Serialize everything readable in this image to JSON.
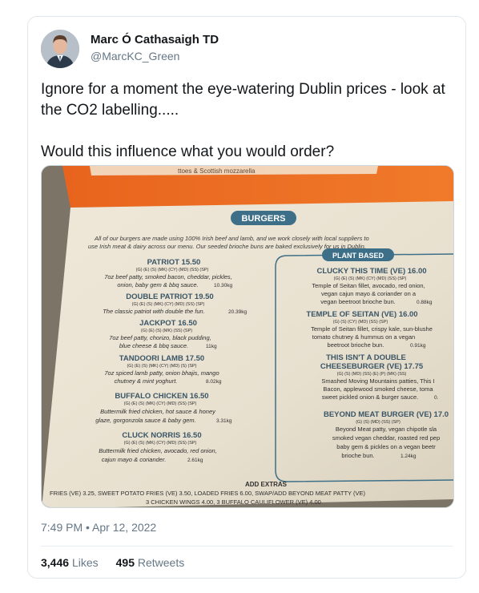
{
  "author": {
    "display_name": "Marc Ó Cathasaigh TD",
    "handle": "@MarcKC_Green"
  },
  "tweet": {
    "text_line1": "Ignore for a moment the eye-watering Dublin prices - look at the CO2 labelling.....",
    "text_line2": "Would this influence what you would order?",
    "timestamp": "7:49 PM • Apr 12, 2022"
  },
  "stats": {
    "likes_count": "3,446",
    "likes_label": "Likes",
    "retweets_count": "495",
    "retweets_label": "Retweets"
  },
  "menu_photo": {
    "top_strip": "ttoes & Scottish mozzarella",
    "title": "BURGERS",
    "intro_line1": "All of our burgers are made using 100% Irish beef and lamb, and we work closely with local suppliers to",
    "intro_line2": "use Irish meat & dairy across our menu. Our seeded brioche buns are baked exclusively for us in Dublin.",
    "plant_badge": "PLANT BASED",
    "left_items": [
      {
        "name": "PATRIOT 15.50",
        "allergens": "(G) (E) (S) (MK) (CY) (MD) (SS) (SP)",
        "desc1": "7oz beef patty, smoked bacon, cheddar, pickles,",
        "desc2": "onion, baby gem & bbq sauce.",
        "co2": "10.30kg"
      },
      {
        "name": "DOUBLE PATRIOT 19.50",
        "allergens": "(G) (E) (S) (MK) (CY) (MD) (SS) (SP)",
        "desc1": "The classic patriot with double the fun.",
        "desc2": "",
        "co2": "20.39kg"
      },
      {
        "name": "JACKPOT 16.50",
        "allergens": "(G) (E) (S) (MK) (SS) (SP)",
        "desc1": "7oz beef patty, chorizo, black pudding,",
        "desc2": "blue cheese & bbq sauce.",
        "co2": "11kg"
      },
      {
        "name": "TANDOORI LAMB 17.50",
        "allergens": "(G) (E) (S) (MK) (CY) (MD) (S) (SP)",
        "desc1": "7oz spiced lamb patty, onion bhajis, mango",
        "desc2": "chutney & mint yoghurt.",
        "co2": "8.02kg"
      },
      {
        "name": "BUFFALO CHICKEN 16.50",
        "allergens": "(G) (E) (S) (MK) (CY) (MD) (SS) (SP)",
        "desc1": "Buttermilk fried chicken, hot sauce & honey",
        "desc2": "glaze, gorgonzola sauce & baby gem.",
        "co2": "3.31kg"
      },
      {
        "name": "CLUCK NORRIS 16.50",
        "allergens": "(G) (E) (S) (MK) (CY) (MD) (SS) (SP)",
        "desc1": "Buttermilk fried chicken, avocado, red onion,",
        "desc2": "cajun mayo & coriander.",
        "co2": "2.61kg"
      }
    ],
    "right_items": [
      {
        "name": "CLUCKY THIS TIME (VE) 16.00",
        "allergens": "(G) (E) (S) (MK) (CY) (MD) (SS) (SP)",
        "desc1": "Temple of Seitan fillet, avocado, red onion,",
        "desc2": "vegan cajun mayo & coriander on a",
        "desc3": "vegan beetroot brioche bun.",
        "co2": "0.88kg"
      },
      {
        "name": "TEMPLE OF SEITAN (VE) 16.00",
        "allergens": "(G) (S) (CY) (MD) (SS) (SP)",
        "desc1": "Temple of Seitan fillet, crispy kale, sun-blushe",
        "desc2": "tomato chutney & hummus on a vegan",
        "desc3": "beetroot brioche bun.",
        "co2": "0.91kg"
      },
      {
        "name": "THIS ISN'T A DOUBLE",
        "name2": "CHEESEBURGER (VE) 17.75",
        "allergens": "(G) (S) (MD) (SS) (E) (P) (MK) (SS)",
        "desc1": "Smashed Moving Mountains patties, This I",
        "desc2": "Bacon, applewood smoked cheese, toma",
        "desc3": "sweet pickled onion & burger sauce.",
        "co2": "0."
      },
      {
        "name": "BEYOND MEAT BURGER (VE) 17.0",
        "allergens": "(G) (S) (MD) (SS) (SP)",
        "desc1": "Beyond Meat patty, vegan chipotle sla",
        "desc2": "smoked vegan cheddar, roasted red pep",
        "desc3": "baby gem & pickles on a vegan beetr",
        "desc4": "brioche bun.",
        "co2": "1.24kg"
      }
    ],
    "extras_title": "ADD EXTRAS",
    "extras_line1": "FRIES (VE) 3.25,  SWEET POTATO FRIES (VE) 3.50,  LOADED FRIES 6.00,  SWAP/ADD BEYOND MEAT PATTY (VE)",
    "extras_line2": "3 CHICKEN WINGS  4.00,  3 BUFFALO CAULIFLOWER  (VE) 4.00"
  }
}
